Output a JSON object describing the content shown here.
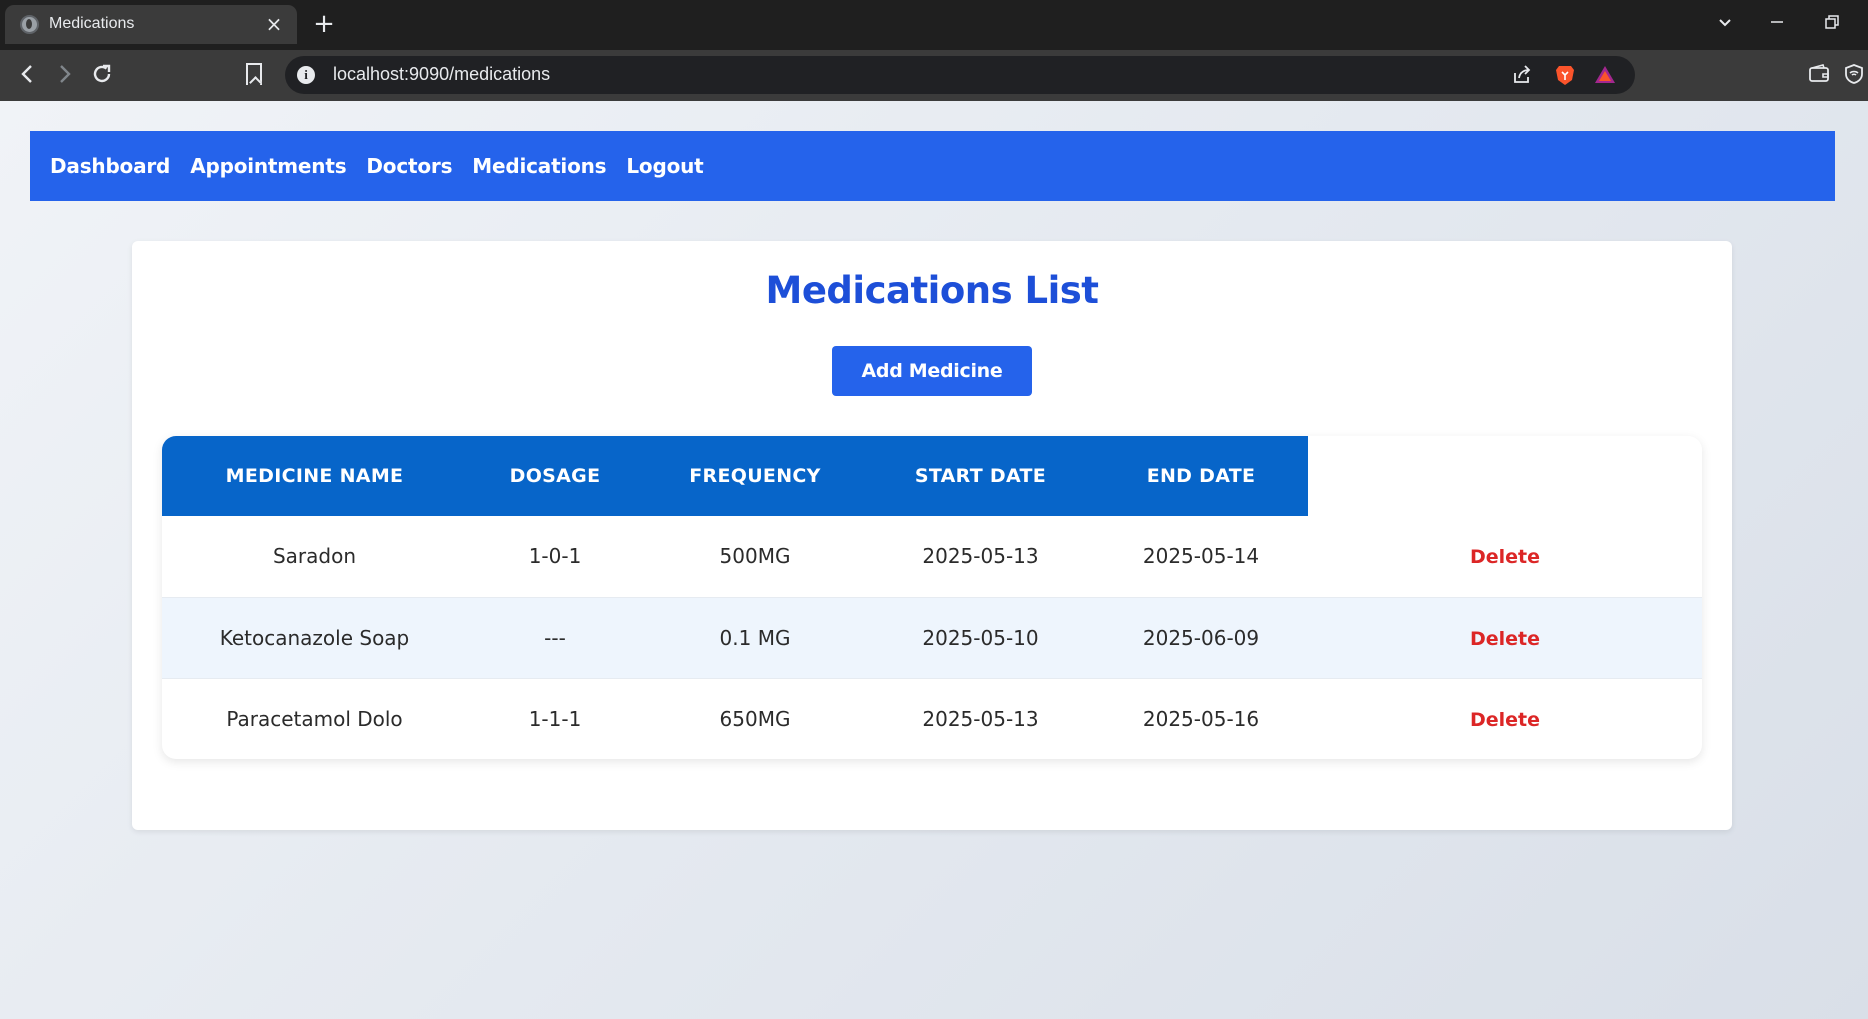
{
  "browser": {
    "tab_title": "Medications",
    "tab_close": "×",
    "new_tab": "+",
    "url": "localhost:9090/medications",
    "controls": {
      "dropdown": "⌄",
      "minimize": "—",
      "restore": "❐"
    }
  },
  "navbar": {
    "links": [
      "Dashboard",
      "Appointments",
      "Doctors",
      "Medications",
      "Logout"
    ]
  },
  "page": {
    "title": "Medications List",
    "add_button": "Add Medicine"
  },
  "table": {
    "headers": [
      "MEDICINE NAME",
      "DOSAGE",
      "FREQUENCY",
      "START DATE",
      "END DATE"
    ],
    "rows": [
      {
        "name": "Saradon",
        "dosage": "1-0-1",
        "frequency": "500MG",
        "start": "2025-05-13",
        "end": "2025-05-14",
        "action": "Delete"
      },
      {
        "name": "Ketocanazole Soap",
        "dosage": "---",
        "frequency": "0.1 MG",
        "start": "2025-05-10",
        "end": "2025-06-09",
        "action": "Delete"
      },
      {
        "name": "Paracetamol Dolo",
        "dosage": "1-1-1",
        "frequency": "650MG",
        "start": "2025-05-13",
        "end": "2025-05-16",
        "action": "Delete"
      }
    ]
  },
  "colors": {
    "navbar": "#2563eb",
    "title": "#1d4fd8",
    "table_header": "#0765c9",
    "delete": "#dc2626",
    "brave_orange": "#fb542b"
  }
}
